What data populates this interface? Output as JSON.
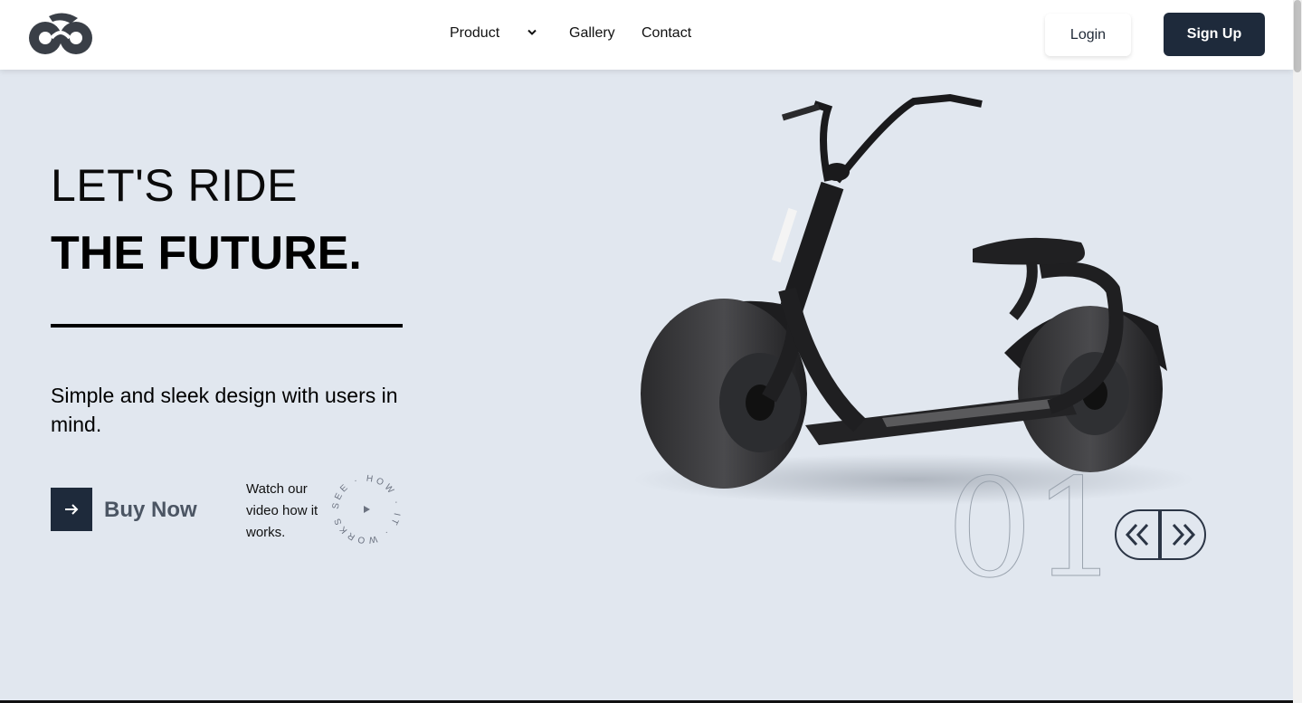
{
  "nav": {
    "product": "Product",
    "gallery": "Gallery",
    "contact": "Contact",
    "login": "Login",
    "signup": "Sign Up"
  },
  "hero": {
    "title_light": "LET'S RIDE",
    "title_bold": "THE FUTURE.",
    "tagline": "Simple and sleek design with users in mind.",
    "buy_label": "Buy Now",
    "watch_text": "Watch our video how it works.",
    "badge_text": "SEE · HOW · IT · WORKS ·"
  },
  "slider": {
    "current": "01"
  },
  "icons": {
    "logo": "bike-logo-icon",
    "chevron": "chevron-down-icon",
    "arrow": "arrow-right-icon",
    "play": "play-icon",
    "prev": "double-chevron-left-icon",
    "next": "double-chevron-right-icon"
  },
  "colors": {
    "background": "#e1e7ef",
    "accent": "#1e2a3b",
    "header": "#ffffff"
  }
}
